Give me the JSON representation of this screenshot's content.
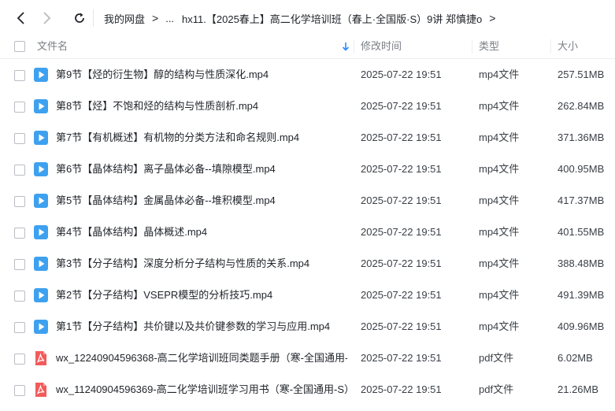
{
  "nav": {
    "back_icon": "chevron-left-icon",
    "forward_icon": "chevron-right-icon",
    "refresh_icon": "refresh-icon"
  },
  "breadcrumb": {
    "root": "我的网盘",
    "ellipsis": "...",
    "current": "hx11.【2025春上】高二化学培训班（春上·全国版·S）9讲 郑慎捷o"
  },
  "header": {
    "name": "文件名",
    "modified": "修改时间",
    "type": "类型",
    "size": "大小",
    "sort_icon": "sort-down-arrow-icon"
  },
  "colors": {
    "video_icon": "#3ea1f0",
    "pdf_icon": "#f25b5b",
    "sort_arrow": "#2f88ff"
  },
  "files": [
    {
      "name": "第9节【烃的衍生物】醇的结构与性质深化.mp4",
      "time": "2025-07-22 19:51",
      "type": "mp4文件",
      "size": "257.51MB",
      "icon": "video-file-icon"
    },
    {
      "name": "第8节【烃】不饱和烃的结构与性质剖析.mp4",
      "time": "2025-07-22 19:51",
      "type": "mp4文件",
      "size": "262.84MB",
      "icon": "video-file-icon"
    },
    {
      "name": "第7节【有机概述】有机物的分类方法和命名规则.mp4",
      "time": "2025-07-22 19:51",
      "type": "mp4文件",
      "size": "371.36MB",
      "icon": "video-file-icon"
    },
    {
      "name": "第6节【晶体结构】离子晶体必备--填隙模型.mp4",
      "time": "2025-07-22 19:51",
      "type": "mp4文件",
      "size": "400.95MB",
      "icon": "video-file-icon"
    },
    {
      "name": "第5节【晶体结构】金属晶体必备--堆积模型.mp4",
      "time": "2025-07-22 19:51",
      "type": "mp4文件",
      "size": "417.37MB",
      "icon": "video-file-icon"
    },
    {
      "name": "第4节【晶体结构】晶体概述.mp4",
      "time": "2025-07-22 19:51",
      "type": "mp4文件",
      "size": "401.55MB",
      "icon": "video-file-icon"
    },
    {
      "name": "第3节【分子结构】深度分析分子结构与性质的关系.mp4",
      "time": "2025-07-22 19:51",
      "type": "mp4文件",
      "size": "388.48MB",
      "icon": "video-file-icon"
    },
    {
      "name": "第2节【分子结构】VSEPR模型的分析技巧.mp4",
      "time": "2025-07-22 19:51",
      "type": "mp4文件",
      "size": "491.39MB",
      "icon": "video-file-icon"
    },
    {
      "name": "第1节【分子结构】共价键以及共价键参数的学习与应用.mp4",
      "time": "2025-07-22 19:51",
      "type": "mp4文件",
      "size": "409.96MB",
      "icon": "video-file-icon"
    },
    {
      "name": "wx_12240904596368-高二化学培训班同类题手册（寒-全国通用-S...",
      "time": "2025-07-22 19:51",
      "type": "pdf文件",
      "size": "6.02MB",
      "icon": "pdf-file-icon"
    },
    {
      "name": "wx_11240904596369-高二化学培训班学习用书（寒-全国通用-S）...",
      "time": "2025-07-22 19:51",
      "type": "pdf文件",
      "size": "21.26MB",
      "icon": "pdf-file-icon"
    }
  ]
}
